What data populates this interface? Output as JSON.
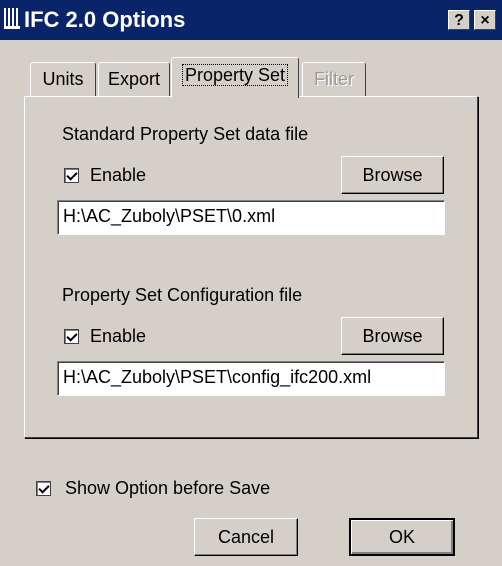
{
  "window": {
    "title": "IFC 2.0 Options",
    "help_label": "?",
    "close_label": "×"
  },
  "tabs": [
    {
      "label": "Units",
      "state": "normal"
    },
    {
      "label": "Export",
      "state": "normal"
    },
    {
      "label": "Property Set",
      "state": "active"
    },
    {
      "label": "Filter",
      "state": "disabled"
    }
  ],
  "standard": {
    "heading": "Standard Property Set data file",
    "enable_label": "Enable",
    "enabled": true,
    "browse_label": "Browse",
    "path": "H:\\AC_Zuboly\\PSET\\0.xml"
  },
  "config": {
    "heading": "Property Set Configuration file",
    "enable_label": "Enable",
    "enabled": true,
    "browse_label": "Browse",
    "path": "H:\\AC_Zuboly\\PSET\\config_ifc200.xml"
  },
  "footer": {
    "show_option_label": "Show Option before Save",
    "show_option_checked": true,
    "cancel_label": "Cancel",
    "ok_label": "OK"
  }
}
